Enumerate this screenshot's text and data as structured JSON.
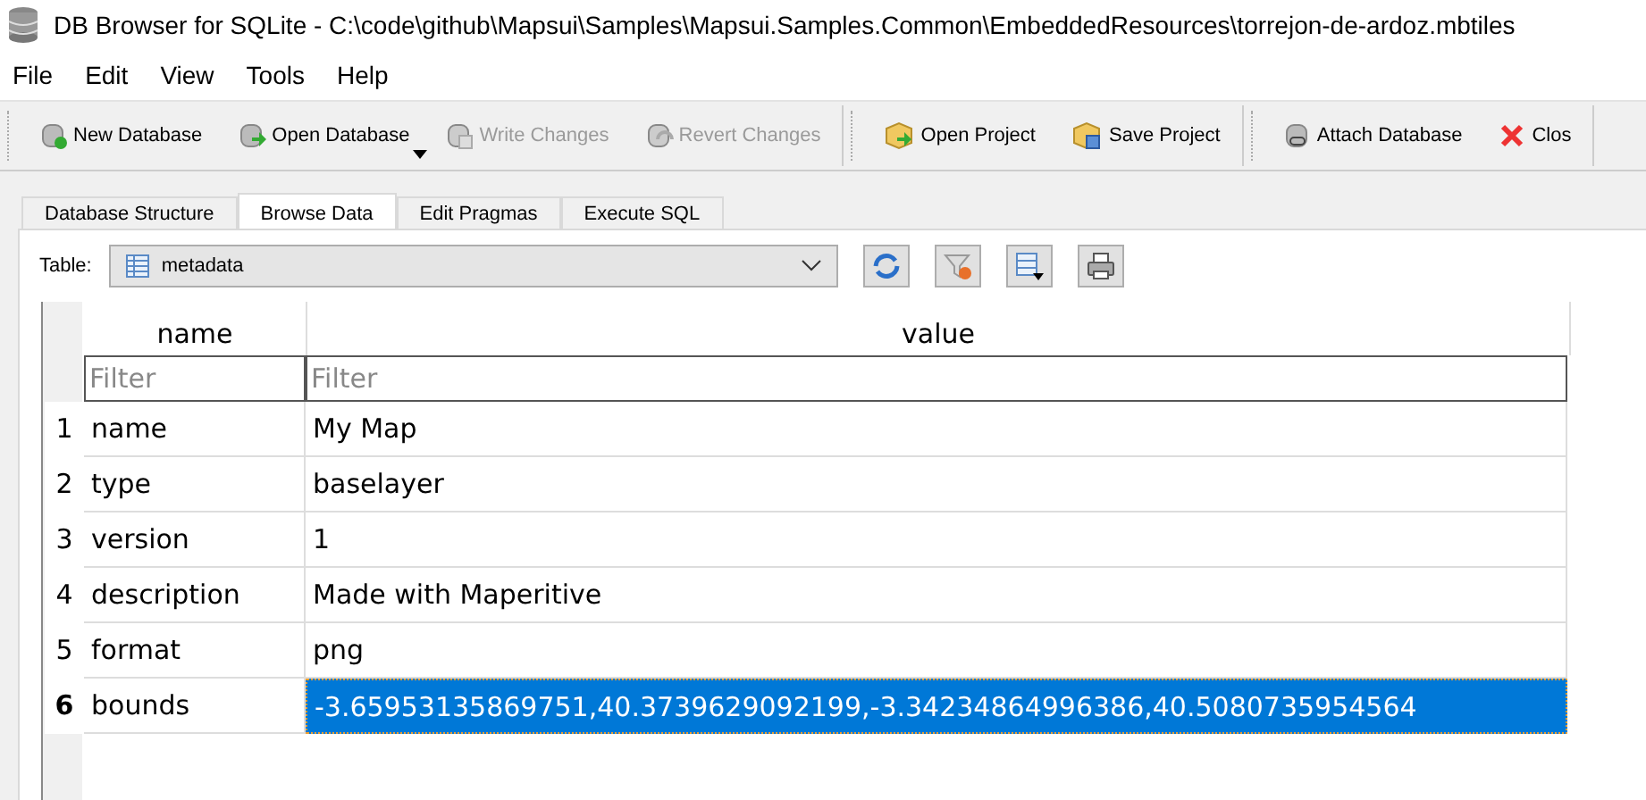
{
  "window": {
    "title": "DB Browser for SQLite - C:\\code\\github\\Mapsui\\Samples\\Mapsui.Samples.Common\\EmbeddedResources\\torrejon-de-ardoz.mbtiles"
  },
  "menu": [
    "File",
    "Edit",
    "View",
    "Tools",
    "Help"
  ],
  "toolbar_groups": [
    {
      "buttons": [
        {
          "label": "New Database",
          "kind": "new",
          "disabled": false
        },
        {
          "label": "Open Database",
          "kind": "open",
          "disabled": false,
          "dropdown": true
        },
        {
          "label": "Write Changes",
          "kind": "write",
          "disabled": true
        },
        {
          "label": "Revert Changes",
          "kind": "revert",
          "disabled": true
        }
      ]
    },
    {
      "buttons": [
        {
          "label": "Open Project",
          "kind": "openproject",
          "disabled": false
        },
        {
          "label": "Save Project",
          "kind": "saveproject",
          "disabled": false
        }
      ]
    },
    {
      "buttons": [
        {
          "label": "Attach Database",
          "kind": "attach",
          "disabled": false
        },
        {
          "label": "Clos",
          "kind": "close",
          "disabled": false
        }
      ]
    }
  ],
  "tabs": [
    {
      "label": "Database Structure",
      "selected": false
    },
    {
      "label": "Browse Data",
      "selected": true
    },
    {
      "label": "Edit Pragmas",
      "selected": false
    },
    {
      "label": "Execute SQL",
      "selected": false
    }
  ],
  "table_picker": {
    "label": "Table:",
    "value": "metadata"
  },
  "grid": {
    "columns": [
      {
        "name": "name",
        "filter_placeholder": "Filter"
      },
      {
        "name": "value",
        "filter_placeholder": "Filter"
      }
    ],
    "rows": [
      {
        "number": "1",
        "name": "name",
        "value": "My Map",
        "selected": false
      },
      {
        "number": "2",
        "name": "type",
        "value": "baselayer",
        "selected": false
      },
      {
        "number": "3",
        "name": "version",
        "value": "1",
        "selected": false
      },
      {
        "number": "4",
        "name": "description",
        "value": "Made with Maperitive",
        "selected": false
      },
      {
        "number": "5",
        "name": "format",
        "value": "png",
        "selected": false
      },
      {
        "number": "6",
        "name": "bounds",
        "value": "-3.65953135869751,40.3739629092199,-3.34234864996386,40.5080735954564",
        "selected": true
      }
    ]
  }
}
